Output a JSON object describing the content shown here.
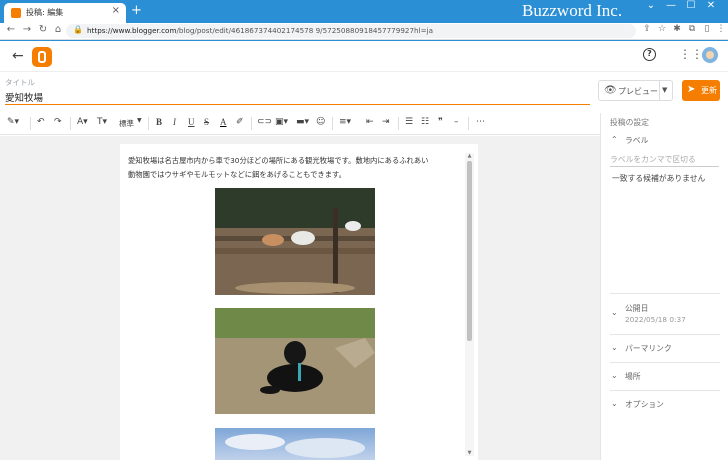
{
  "browser": {
    "tab_title": "投稿: 編集",
    "brand": "Buzzword Inc.",
    "url_host": "https://www.blogger.com",
    "url_path": "/blog/post/edit/461867374402174578 9/57250880918457779927hl=ja"
  },
  "header": {
    "title_label": "タイトル",
    "title_value": "愛知牧場"
  },
  "actions": {
    "preview_label": "プレビュー",
    "update_label": "更新"
  },
  "toolbar": {
    "format_label": "標準"
  },
  "post": {
    "body_line1": "愛知牧場は名古屋市内から車で30分ほどの場所にある観光牧場です。敷地内にあるふれあい",
    "body_line2": "動物園ではウサギやモルモットなどに餌をあげることもできます。"
  },
  "sidebar": {
    "heading": "投稿の設定",
    "labels_section": "ラベル",
    "labels_placeholder": "ラベルをカンマで区切る",
    "no_match": "一致する候補がありません",
    "published_label": "公開日",
    "published_value": "2022/05/18 0:37",
    "permalink": "パーマリンク",
    "location": "場所",
    "options": "オプション"
  },
  "colors": {
    "accent": "#f57d00",
    "chrome": "#2b8fd6"
  }
}
